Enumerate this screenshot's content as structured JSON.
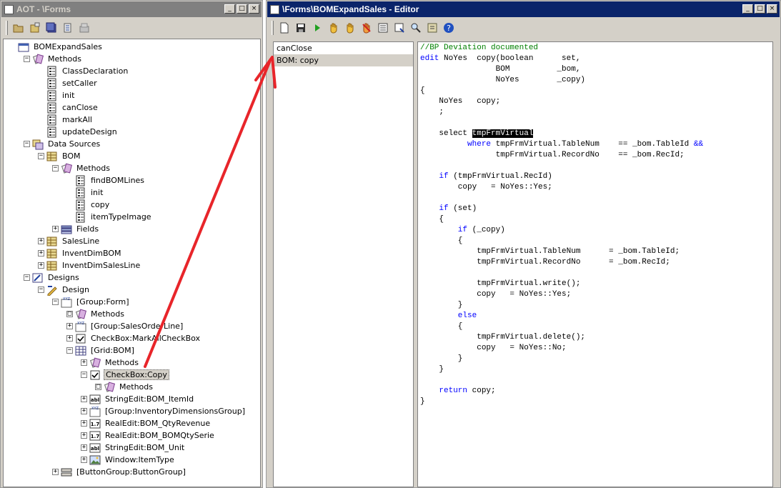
{
  "aot": {
    "title": "AOT - \\Forms",
    "tree": [
      {
        "label": "BOMExpandSales",
        "icon": "form-icon",
        "expander": "",
        "selected": false
      },
      {
        "label": "Methods",
        "icon": "methods-icon",
        "expander": "−",
        "selected": false
      },
      {
        "label": "ClassDeclaration",
        "icon": "method-icon",
        "expander": "",
        "selected": false
      },
      {
        "label": "setCaller",
        "icon": "method-icon",
        "expander": "",
        "selected": false
      },
      {
        "label": "init",
        "icon": "method-icon",
        "expander": "",
        "selected": false
      },
      {
        "label": "canClose",
        "icon": "method-icon",
        "expander": "",
        "selected": false
      },
      {
        "label": "markAll",
        "icon": "method-icon",
        "expander": "",
        "selected": false
      },
      {
        "label": "updateDesign",
        "icon": "method-icon",
        "expander": "",
        "selected": false
      },
      {
        "label": "Data Sources",
        "icon": "datasources-icon",
        "expander": "−",
        "selected": false
      },
      {
        "label": "BOM",
        "icon": "table-icon",
        "expander": "−",
        "selected": false
      },
      {
        "label": "Methods",
        "icon": "methods-icon",
        "expander": "−",
        "selected": false
      },
      {
        "label": "findBOMLines",
        "icon": "method-icon",
        "expander": "",
        "selected": false
      },
      {
        "label": "init",
        "icon": "method-icon",
        "expander": "",
        "selected": false
      },
      {
        "label": "copy",
        "icon": "method-icon",
        "expander": "",
        "selected": false
      },
      {
        "label": "itemTypeImage",
        "icon": "method-icon",
        "expander": "",
        "selected": false
      },
      {
        "label": "Fields",
        "icon": "fields-icon",
        "expander": "+",
        "selected": false
      },
      {
        "label": "SalesLine",
        "icon": "table-icon",
        "expander": "+",
        "selected": false
      },
      {
        "label": "InventDimBOM",
        "icon": "table-icon",
        "expander": "+",
        "selected": false
      },
      {
        "label": "InventDimSalesLine",
        "icon": "table-icon",
        "expander": "+",
        "selected": false
      },
      {
        "label": "Designs",
        "icon": "designs-icon",
        "expander": "−",
        "selected": false
      },
      {
        "label": "Design",
        "icon": "design-icon",
        "expander": "−",
        "selected": false
      },
      {
        "label": "[Group:Form]",
        "icon": "group-icon",
        "expander": "−",
        "selected": false
      },
      {
        "label": "Methods",
        "icon": "methods-icon",
        "expander": "□",
        "selected": false
      },
      {
        "label": "[Group:SalesOrderLine]",
        "icon": "group-icon",
        "expander": "+",
        "selected": false
      },
      {
        "label": "CheckBox:MarkAllCheckBox",
        "icon": "checkbox-icon",
        "expander": "+",
        "selected": false
      },
      {
        "label": "[Grid:BOM]",
        "icon": "grid-icon",
        "expander": "−",
        "selected": false
      },
      {
        "label": "Methods",
        "icon": "methods-icon",
        "expander": "+",
        "selected": false
      },
      {
        "label": "CheckBox:Copy",
        "icon": "checkbox-icon",
        "expander": "−",
        "selected": true
      },
      {
        "label": "Methods",
        "icon": "methods-icon",
        "expander": "□",
        "selected": false
      },
      {
        "label": "StringEdit:BOM_ItemId",
        "icon": "stringedit-icon",
        "expander": "+",
        "selected": false
      },
      {
        "label": "[Group:InventoryDimensionsGroup]",
        "icon": "group-icon",
        "expander": "+",
        "selected": false
      },
      {
        "label": "RealEdit:BOM_QtyRevenue",
        "icon": "realedit-icon",
        "expander": "+",
        "selected": false
      },
      {
        "label": "RealEdit:BOM_BOMQtySerie",
        "icon": "realedit-icon",
        "expander": "+",
        "selected": false
      },
      {
        "label": "StringEdit:BOM_Unit",
        "icon": "stringedit-icon",
        "expander": "+",
        "selected": false
      },
      {
        "label": "Window:ItemType",
        "icon": "window-icon",
        "expander": "+",
        "selected": false
      },
      {
        "label": "[ButtonGroup:ButtonGroup]",
        "icon": "buttongroup-icon",
        "expander": "+",
        "selected": false
      }
    ],
    "icon_text": {
      "realedit": "1.7",
      "stringedit": "abl"
    }
  },
  "editor": {
    "title": "\\Forms\\BOMExpandSales - Editor",
    "methods": [
      {
        "label": "canClose",
        "selected": false
      },
      {
        "label": "BOM: copy",
        "selected": true
      }
    ],
    "code": [
      {
        "segments": [
          {
            "t": "//BP Deviation documented",
            "c": "cm"
          }
        ]
      },
      {
        "segments": [
          {
            "t": "edit",
            "c": "kw"
          },
          {
            "t": " NoYes  copy(boolean      set,",
            "c": ""
          }
        ]
      },
      {
        "segments": [
          {
            "t": "                BOM          _bom,",
            "c": ""
          }
        ]
      },
      {
        "segments": [
          {
            "t": "                NoYes        _copy)",
            "c": ""
          }
        ]
      },
      {
        "segments": [
          {
            "t": "{",
            "c": ""
          }
        ]
      },
      {
        "segments": [
          {
            "t": "    NoYes   copy;",
            "c": ""
          }
        ]
      },
      {
        "segments": [
          {
            "t": "    ;",
            "c": ""
          }
        ]
      },
      {
        "segments": [
          {
            "t": "",
            "c": ""
          }
        ]
      },
      {
        "segments": [
          {
            "t": "    select ",
            "c": ""
          },
          {
            "t": "tmpFrmVirtual",
            "c": "hl"
          }
        ]
      },
      {
        "segments": [
          {
            "t": "          where",
            "c": "kw"
          },
          {
            "t": " tmpFrmVirtual.TableNum    == _bom.TableId ",
            "c": ""
          },
          {
            "t": "&&",
            "c": "kw"
          }
        ]
      },
      {
        "segments": [
          {
            "t": "                tmpFrmVirtual.RecordNo    == _bom.RecId;",
            "c": ""
          }
        ]
      },
      {
        "segments": [
          {
            "t": "",
            "c": ""
          }
        ]
      },
      {
        "segments": [
          {
            "t": "    if",
            "c": "kw"
          },
          {
            "t": " (tmpFrmVirtual.RecId)",
            "c": ""
          }
        ]
      },
      {
        "segments": [
          {
            "t": "        copy   = NoYes::Yes;",
            "c": ""
          }
        ]
      },
      {
        "segments": [
          {
            "t": "",
            "c": ""
          }
        ]
      },
      {
        "segments": [
          {
            "t": "    if",
            "c": "kw"
          },
          {
            "t": " (set)",
            "c": ""
          }
        ]
      },
      {
        "segments": [
          {
            "t": "    {",
            "c": ""
          }
        ]
      },
      {
        "segments": [
          {
            "t": "        if",
            "c": "kw"
          },
          {
            "t": " (_copy)",
            "c": ""
          }
        ]
      },
      {
        "segments": [
          {
            "t": "        {",
            "c": ""
          }
        ]
      },
      {
        "segments": [
          {
            "t": "            tmpFrmVirtual.TableNum      = _bom.TableId;",
            "c": ""
          }
        ]
      },
      {
        "segments": [
          {
            "t": "            tmpFrmVirtual.RecordNo      = _bom.RecId;",
            "c": ""
          }
        ]
      },
      {
        "segments": [
          {
            "t": "",
            "c": ""
          }
        ]
      },
      {
        "segments": [
          {
            "t": "            tmpFrmVirtual.write();",
            "c": ""
          }
        ]
      },
      {
        "segments": [
          {
            "t": "            copy   = NoYes::Yes;",
            "c": ""
          }
        ]
      },
      {
        "segments": [
          {
            "t": "        }",
            "c": ""
          }
        ]
      },
      {
        "segments": [
          {
            "t": "        else",
            "c": "kw"
          }
        ]
      },
      {
        "segments": [
          {
            "t": "        {",
            "c": ""
          }
        ]
      },
      {
        "segments": [
          {
            "t": "            tmpFrmVirtual.delete();",
            "c": ""
          }
        ]
      },
      {
        "segments": [
          {
            "t": "            copy   = NoYes::No;",
            "c": ""
          }
        ]
      },
      {
        "segments": [
          {
            "t": "        }",
            "c": ""
          }
        ]
      },
      {
        "segments": [
          {
            "t": "    }",
            "c": ""
          }
        ]
      },
      {
        "segments": [
          {
            "t": "",
            "c": ""
          }
        ]
      },
      {
        "segments": [
          {
            "t": "    return",
            "c": "kw"
          },
          {
            "t": " copy;",
            "c": ""
          }
        ]
      },
      {
        "segments": [
          {
            "t": "}",
            "c": ""
          }
        ]
      }
    ]
  },
  "colors": {
    "arrow": "#e8252a",
    "keyword": "#0000ff",
    "comment": "#008000",
    "active_title": "#0a246a",
    "inactive_title": "#808080"
  }
}
